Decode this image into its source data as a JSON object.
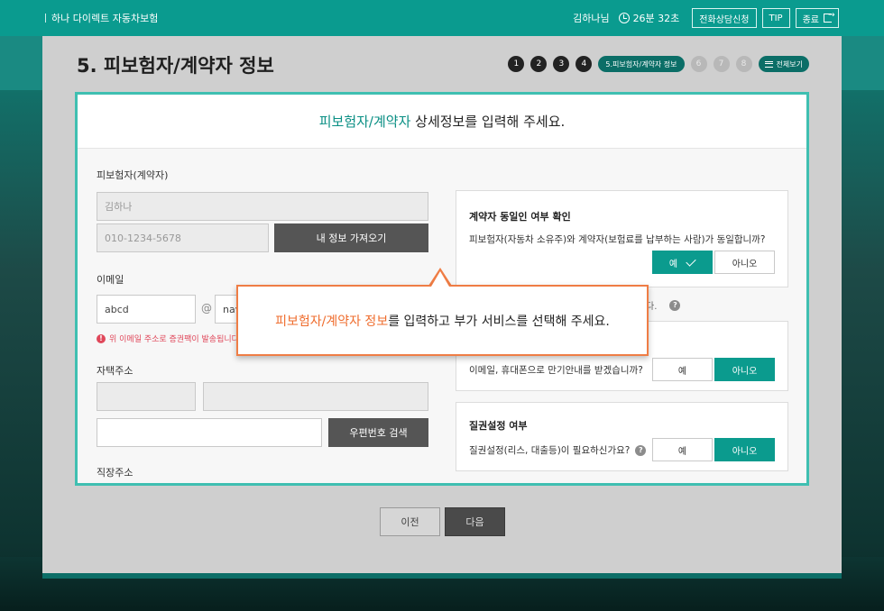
{
  "header": {
    "brand": "하나 다이렉트 자동차보험",
    "user": "김하나님",
    "timer": "26분 32초",
    "consult_button": "전화상담신청",
    "tip_button": "TIP",
    "exit_button": "종료"
  },
  "page": {
    "title": "5. 피보험자/계약자 정보",
    "steps": [
      "1",
      "2",
      "3",
      "4"
    ],
    "current_step": "5.피보험자/계약자 정보",
    "future_steps": [
      "6",
      "7",
      "8"
    ],
    "all_view_button": "전체보기"
  },
  "card": {
    "heading_accent": "피보험자/계약자",
    "heading_rest": " 상세정보를 입력해 주세요."
  },
  "form": {
    "insured_label": "피보험자(계약자)",
    "name_value": "김하나",
    "phone_value": "010-1234-5678",
    "import_button": "내 정보 가져오기",
    "email_label": "이메일",
    "email_id": "abcd",
    "at_sign": "@",
    "email_domain": "nav",
    "email_warning": "위 이메일 주소로 증권팩이 발송됩니다",
    "home_address_label": "자택주소",
    "zip_search_button": "우편번호 검색",
    "work_address_label": "직장주소"
  },
  "side": {
    "same_person": {
      "title": "계약자 동일인 여부 확인",
      "question": "피보험자(자동차 소유주)와 계약자(보험료를 납부하는 사람)가 동일합니까?",
      "yes": "예",
      "no": "아니오",
      "selected": "yes"
    },
    "note_tail": "다.",
    "notice": {
      "question": "이메일, 휴대폰으로 만기안내를 받겠습니까?",
      "yes": "예",
      "no": "아니오",
      "selected": "no"
    },
    "lien": {
      "title": "질권설정 여부",
      "question": "질권설정(리스, 대출등)이 필요하신가요?",
      "yes": "예",
      "no": "아니오",
      "selected": "no"
    }
  },
  "callout": {
    "highlight": "피보험자/계약자 정보",
    "rest": "를 입력하고 부가 서비스를 선택해 주세요."
  },
  "nav": {
    "prev": "이전",
    "next": "다음"
  },
  "colors": {
    "brand": "#0a9b8f",
    "accent_orange": "#ef7d45",
    "highlight_border": "#3fbfb1"
  }
}
